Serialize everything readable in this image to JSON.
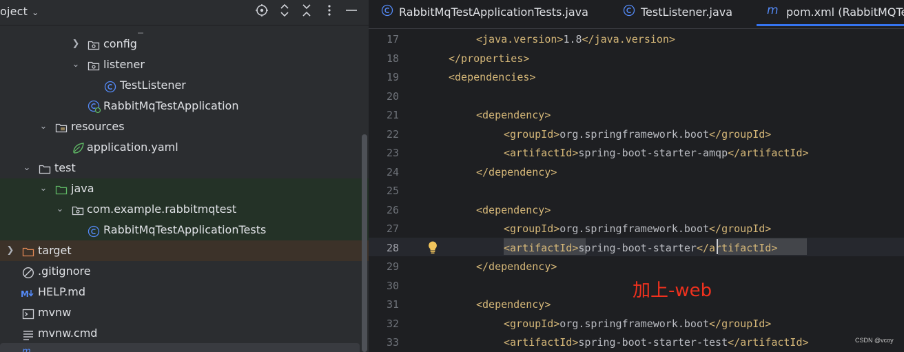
{
  "project": {
    "title": "oject",
    "toolbar_icons": [
      "locate-icon",
      "expand-all-icon",
      "collapse-all-icon",
      "more-icon",
      "hide-icon"
    ]
  },
  "tree": [
    {
      "name": "config",
      "icon": "package-folder-icon",
      "expanded": false
    },
    {
      "name": "listener",
      "icon": "package-folder-icon",
      "expanded": true
    },
    {
      "name": "TestListener",
      "icon": "class-icon"
    },
    {
      "name": "RabbitMqTestApplication",
      "icon": "spring-class-icon"
    },
    {
      "name": "resources",
      "icon": "resources-folder-icon",
      "expanded": true
    },
    {
      "name": "application.yaml",
      "icon": "spring-yaml-icon"
    },
    {
      "name": "test",
      "icon": "folder-icon",
      "expanded": true
    },
    {
      "name": "java",
      "icon": "test-folder-icon",
      "expanded": true
    },
    {
      "name": "com.example.rabbitmqtest",
      "icon": "package-folder-icon",
      "expanded": true
    },
    {
      "name": "RabbitMqTestApplicationTests",
      "icon": "class-icon"
    },
    {
      "name": "target",
      "icon": "excluded-folder-icon",
      "expanded": false
    },
    {
      "name": ".gitignore",
      "icon": "ignore-icon"
    },
    {
      "name": "HELP.md",
      "icon": "markdown-icon"
    },
    {
      "name": "mvnw",
      "icon": "terminal-icon"
    },
    {
      "name": "mvnw.cmd",
      "icon": "text-file-icon"
    }
  ],
  "tabs": [
    {
      "label": "RabbitMqTestApplicationTests.java",
      "icon": "class-icon",
      "active": false
    },
    {
      "label": "TestListener.java",
      "icon": "class-icon",
      "active": false
    },
    {
      "label": "pom.xml (RabbitMQTe",
      "icon": "maven-icon",
      "active": true
    }
  ],
  "editor": {
    "current_line": 28,
    "lines": [
      {
        "n": "17",
        "parts": [
          {
            "t": "<java.version>",
            "c": "tag"
          },
          {
            "t": "1.8",
            "c": "txt"
          },
          {
            "t": "</java.version>",
            "c": "tag"
          }
        ],
        "indent": 1
      },
      {
        "n": "18",
        "parts": [
          {
            "t": "</properties>",
            "c": "tag"
          }
        ],
        "indent": 0
      },
      {
        "n": "19",
        "parts": [
          {
            "t": "<dependencies>",
            "c": "tag"
          }
        ],
        "indent": 0
      },
      {
        "n": "20",
        "parts": [],
        "indent": 0
      },
      {
        "n": "21",
        "parts": [
          {
            "t": "<dependency>",
            "c": "tag"
          }
        ],
        "indent": 1
      },
      {
        "n": "22",
        "parts": [
          {
            "t": "<groupId>",
            "c": "tag"
          },
          {
            "t": "org.springframework.boot",
            "c": "txt"
          },
          {
            "t": "</groupId>",
            "c": "tag"
          }
        ],
        "indent": 2
      },
      {
        "n": "23",
        "parts": [
          {
            "t": "<artifactId>",
            "c": "tag"
          },
          {
            "t": "spring-boot-starter-amqp",
            "c": "txt"
          },
          {
            "t": "</artifactId>",
            "c": "tag"
          }
        ],
        "indent": 2
      },
      {
        "n": "24",
        "parts": [
          {
            "t": "</dependency>",
            "c": "tag"
          }
        ],
        "indent": 1
      },
      {
        "n": "25",
        "parts": [],
        "indent": 0
      },
      {
        "n": "26",
        "parts": [
          {
            "t": "<dependency>",
            "c": "tag"
          }
        ],
        "indent": 1
      },
      {
        "n": "27",
        "parts": [
          {
            "t": "<groupId>",
            "c": "tag"
          },
          {
            "t": "org.springframework.boot",
            "c": "txt"
          },
          {
            "t": "</groupId>",
            "c": "tag"
          }
        ],
        "indent": 2
      },
      {
        "n": "28",
        "parts": [
          {
            "t": "<artifactId>",
            "c": "tag"
          },
          {
            "t": "spring-boot-starter",
            "c": "txt"
          },
          {
            "t": "</artifactId>",
            "c": "tag"
          }
        ],
        "indent": 2
      },
      {
        "n": "29",
        "parts": [
          {
            "t": "</dependency>",
            "c": "tag"
          }
        ],
        "indent": 1
      },
      {
        "n": "30",
        "parts": [],
        "indent": 0
      },
      {
        "n": "31",
        "parts": [
          {
            "t": "<dependency>",
            "c": "tag"
          }
        ],
        "indent": 1
      },
      {
        "n": "32",
        "parts": [
          {
            "t": "<groupId>",
            "c": "tag"
          },
          {
            "t": "org.springframework.boot",
            "c": "txt"
          },
          {
            "t": "</groupId>",
            "c": "tag"
          }
        ],
        "indent": 2
      },
      {
        "n": "33",
        "parts": [
          {
            "t": "<artifactId>",
            "c": "tag"
          },
          {
            "t": "spring-boot-starter-test",
            "c": "txt"
          },
          {
            "t": "</artifactId>",
            "c": "tag"
          }
        ],
        "indent": 2
      }
    ]
  },
  "annotation": "加上-web",
  "watermark": "CSDN @vcoy",
  "colors": {
    "tag": "#d5b778",
    "text": "#bcbec4",
    "annotation": "#f0311e",
    "accent": "#3574f0"
  }
}
